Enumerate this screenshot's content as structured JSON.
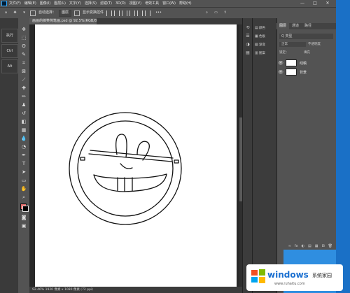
{
  "menubar": {
    "items": [
      "文件(F)",
      "编辑(E)",
      "图像(I)",
      "图层(L)",
      "文字(Y)",
      "选择(S)",
      "滤镜(T)",
      "3D(D)",
      "视图(V)",
      "增效工具",
      "窗口(W)",
      "帮助(H)"
    ],
    "window_controls": [
      "—",
      "□",
      "✕"
    ]
  },
  "options": {
    "auto_select_label": "自动选择：",
    "auto_select_value": "图层",
    "transform_label": "显示变换控件"
  },
  "left_strip": {
    "labels": [
      "执行",
      "Ctrl",
      "Alt"
    ]
  },
  "document": {
    "tab_title": "画画的搞笑简笔画.psd @ 92.5%(RGB/8#) *",
    "status": "92.46%   1920 像素 x 1080 像素 (72 ppi)"
  },
  "panels": {
    "items": [
      {
        "icon": "▤",
        "label": "颜色"
      },
      {
        "icon": "▦",
        "label": "色板"
      },
      {
        "icon": "▧",
        "label": "渐变"
      },
      {
        "icon": "▥",
        "label": "图案"
      }
    ]
  },
  "layers": {
    "tabs": [
      "图层",
      "通道",
      "路径"
    ],
    "filter_value": "Q 类型",
    "blend_mode": "正常",
    "opacity_label": "不透明度",
    "lock_label": "锁定：",
    "fill_label": "填充",
    "rows": [
      {
        "eye": "👁",
        "name": "线稿"
      },
      {
        "eye": "👁",
        "name": "背景"
      }
    ],
    "footer_icons": [
      "∞",
      "fx",
      "◐",
      "▤",
      "▦",
      "⊞",
      "🗑"
    ]
  },
  "watermark": {
    "brand": "windows",
    "sub": "系统家园",
    "url": "www.ruhaitu.com"
  },
  "colors": {
    "foreground": "#e06666",
    "background": "#000000",
    "accent": "#1a70c6"
  }
}
